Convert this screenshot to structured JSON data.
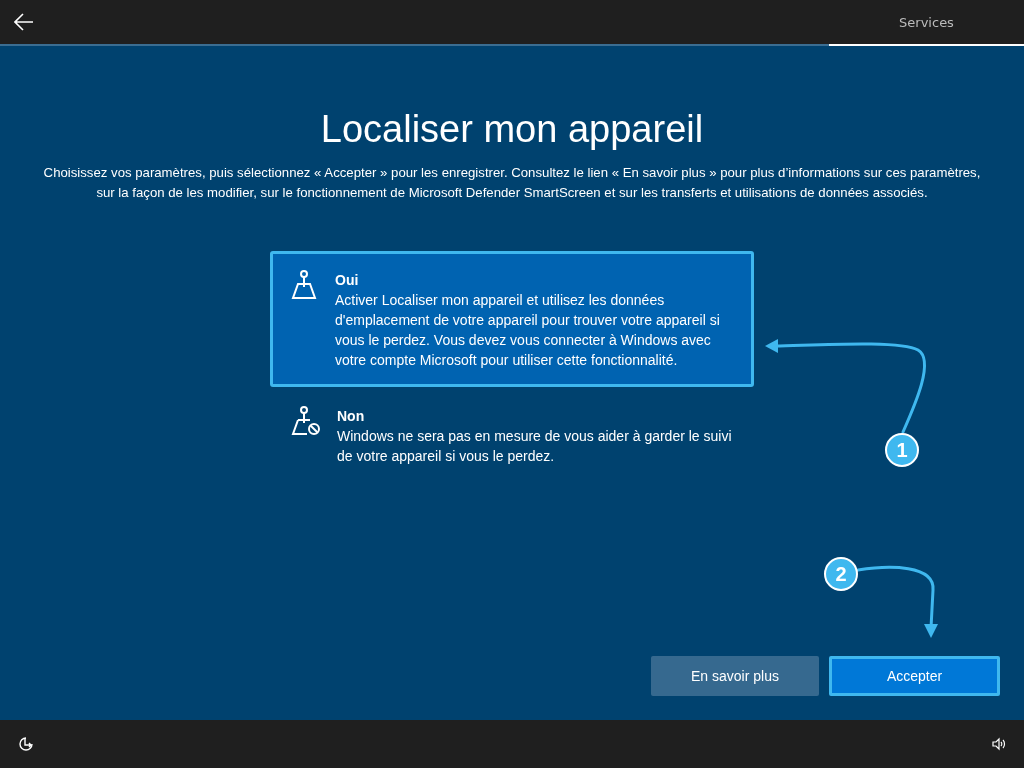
{
  "top_bar": {
    "tabs": [
      {
        "label": "Services",
        "selected": true
      }
    ]
  },
  "title": "Localiser mon appareil",
  "description": "Choisissez vos paramètres, puis sélectionnez « Accepter » pour les enregistrer. Consultez le lien « En savoir plus » pour plus d’informations sur ces paramètres, sur la façon de les modifier, sur le fonctionnement de Microsoft Defender SmartScreen et sur les transferts et utilisations de données associés.",
  "options": [
    {
      "kind": "location",
      "label": "Oui",
      "text": "Activer Localiser mon appareil et utilisez les données d'emplacement de votre appareil pour trouver votre appareil si vous le perdez. Vous devez vous connecter à Windows avec votre compte Microsoft pour utiliser cette fonctionnalité.",
      "selected": true
    },
    {
      "kind": "location-off",
      "label": "Non",
      "text": "Windows ne sera pas en mesure de vous aider à garder le suivi de votre appareil si vous le perdez.",
      "selected": false
    }
  ],
  "buttons": [
    {
      "kind": "secondary",
      "label": "En savoir plus",
      "highlighted": false
    },
    {
      "kind": "primary",
      "label": "Accepter",
      "highlighted": true
    }
  ],
  "annotations": [
    {
      "label": "1"
    },
    {
      "label": "2"
    }
  ]
}
